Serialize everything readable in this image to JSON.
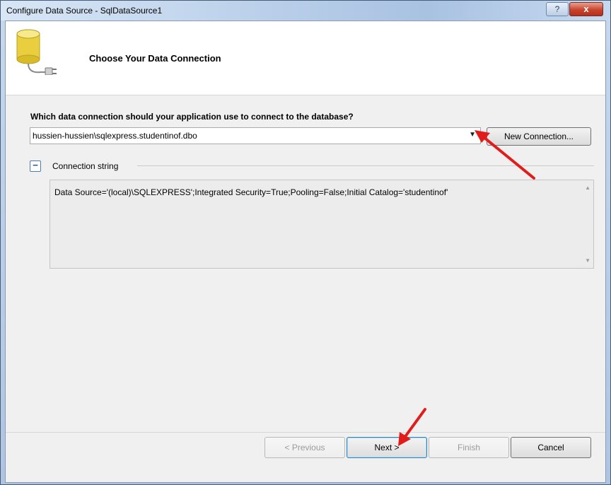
{
  "window": {
    "title": "Configure Data Source - SqlDataSource1",
    "help_glyph": "?",
    "close_glyph": "x"
  },
  "header": {
    "title": "Choose Your Data Connection",
    "icon": "database-icon"
  },
  "connection": {
    "question": "Which data connection should your application use to connect to the database?",
    "selected": "hussien-hussien\\sqlexpress.studentinof.dbo",
    "new_connection_label": "New Connection...",
    "collapse_glyph": "−",
    "string_label": "Connection string",
    "string_value": "Data Source='(local)\\SQLEXPRESS';Integrated Security=True;Pooling=False;Initial Catalog='studentinof'"
  },
  "footer": {
    "previous_label": "< Previous",
    "next_label": "Next >",
    "finish_label": "Finish",
    "cancel_label": "Cancel"
  },
  "colors": {
    "annotation_arrow": "#e21b1b",
    "title_bar": "#b9cfe9",
    "close_button": "#c8432e"
  }
}
